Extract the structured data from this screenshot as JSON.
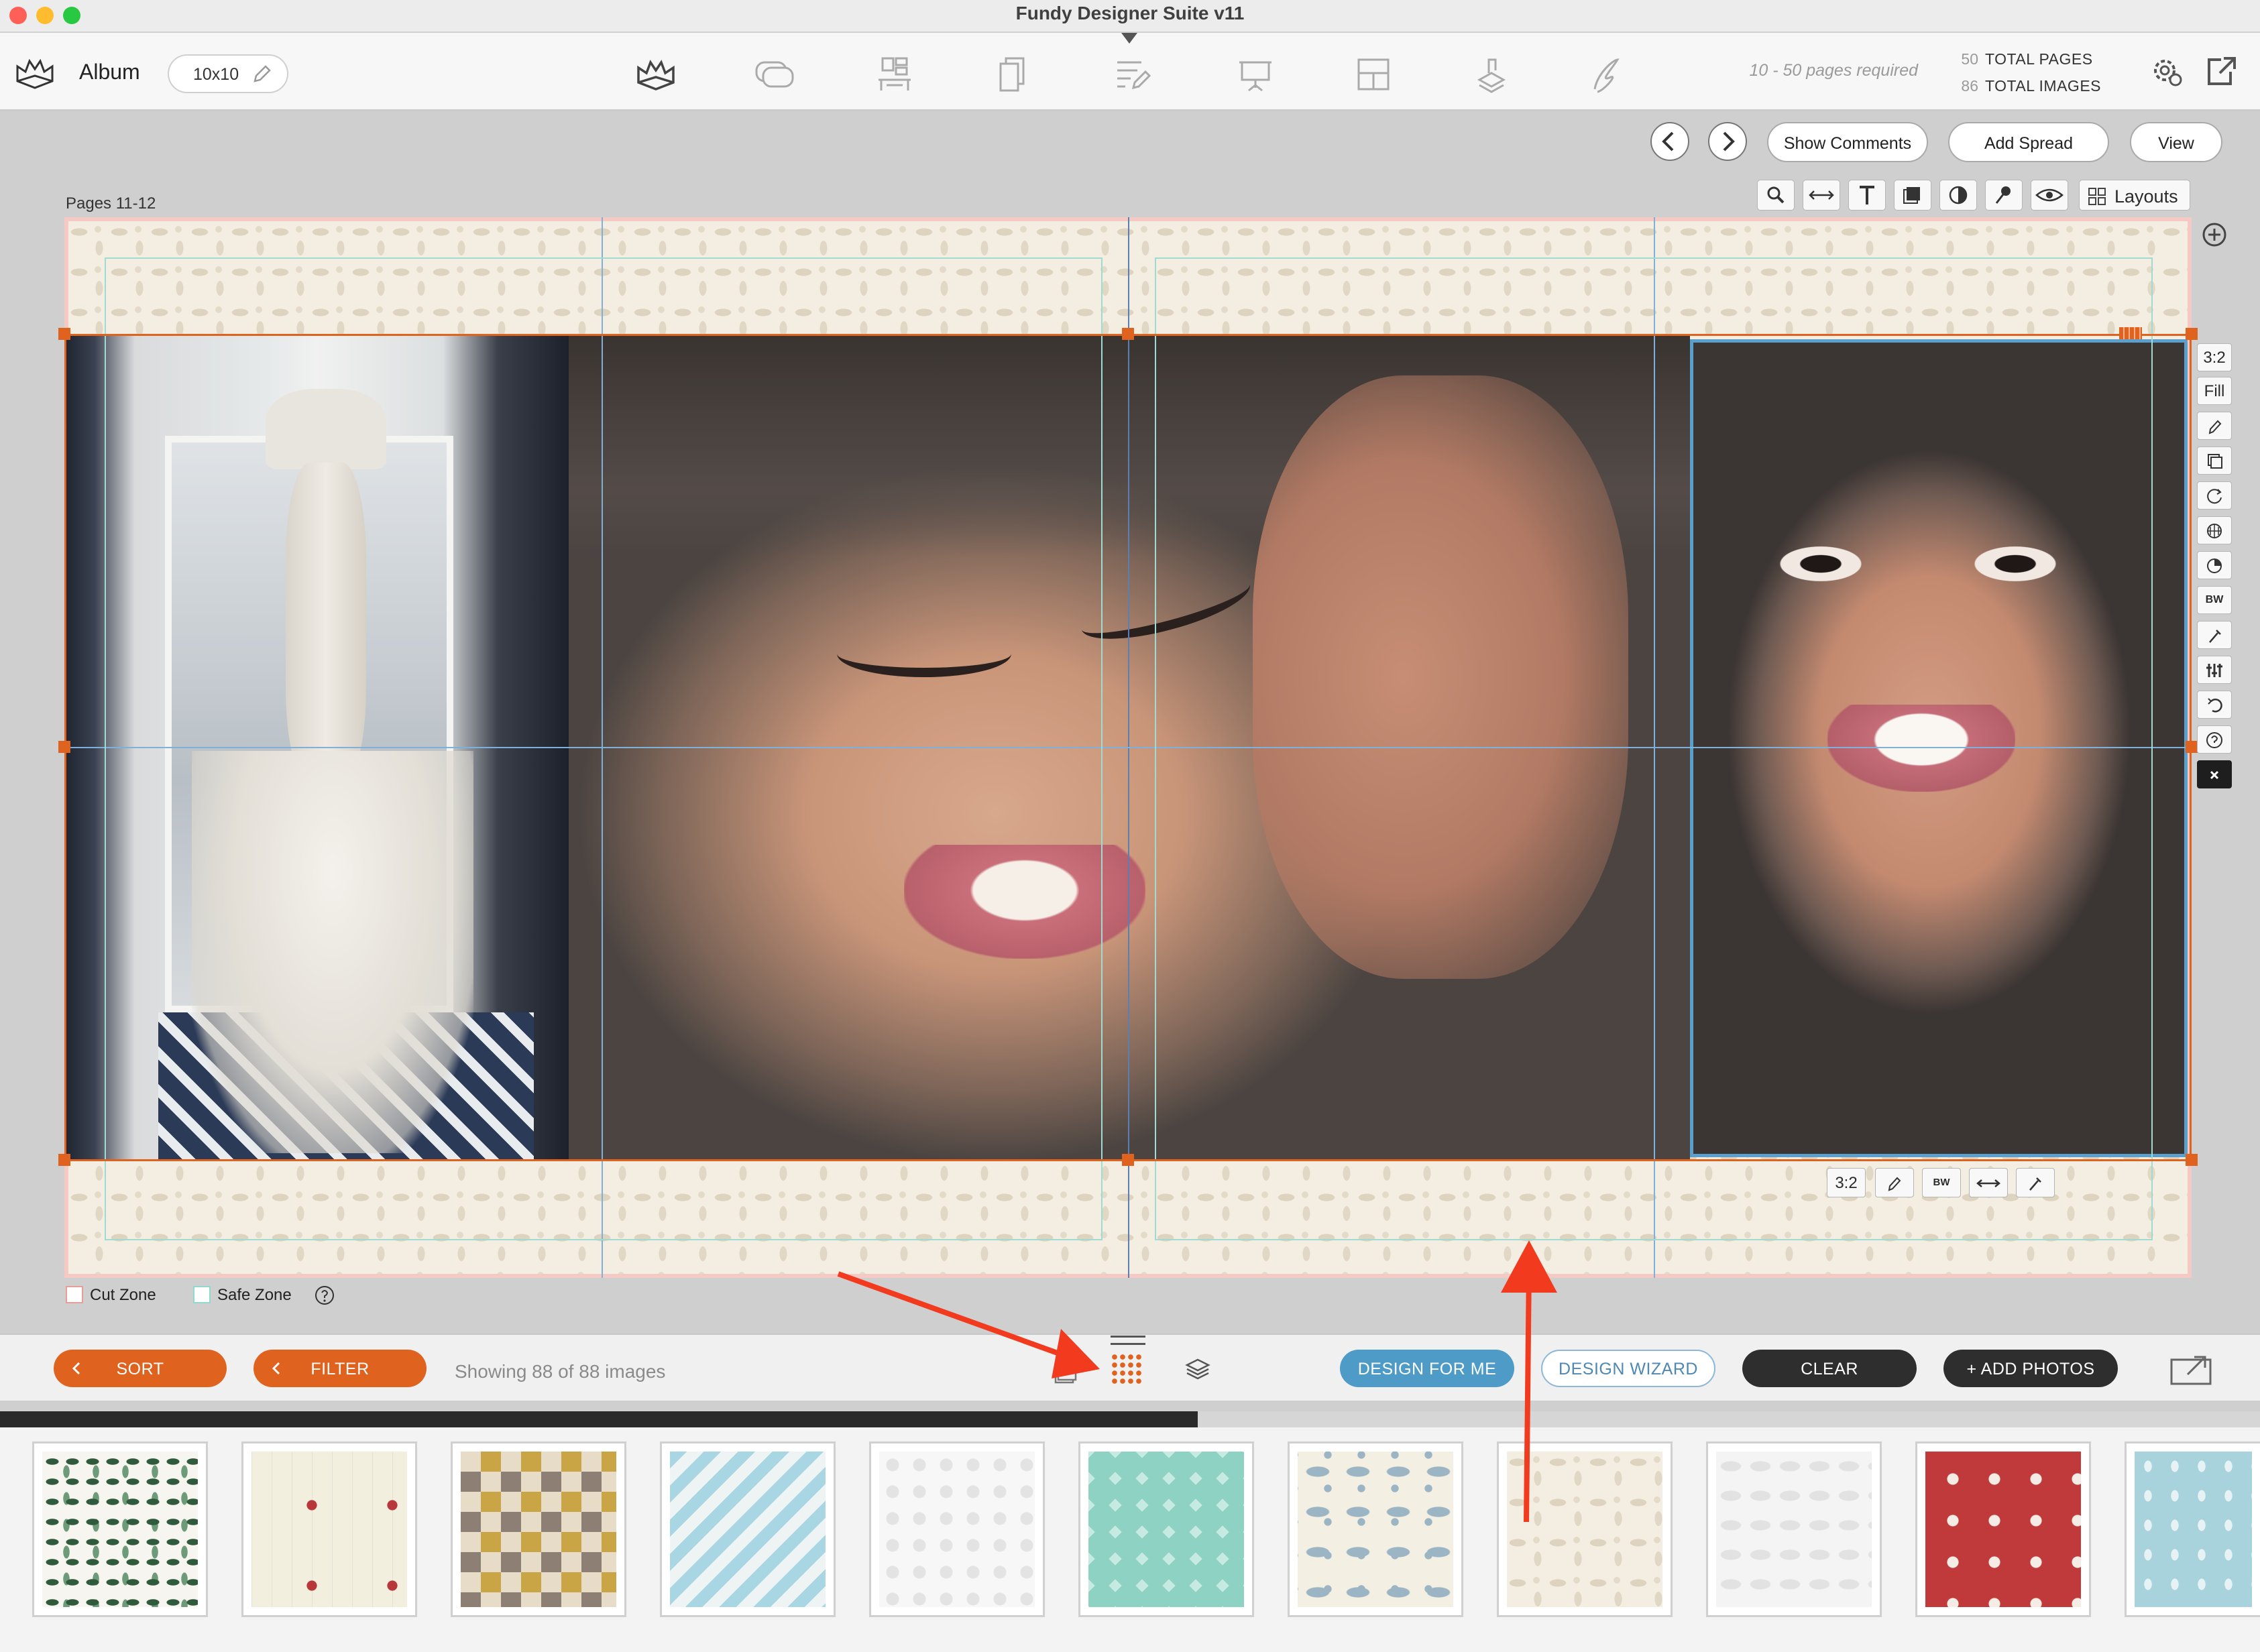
{
  "window": {
    "title": "Fundy Designer Suite v11"
  },
  "toolbar": {
    "product": "Album",
    "size_pill": "10x10",
    "pages_required": "10 - 50 pages required",
    "total_pages_value": "50",
    "total_pages_label": "TOTAL PAGES",
    "total_images_value": "86",
    "total_images_label": "TOTAL IMAGES",
    "tab_icons": [
      "album-icon",
      "comments-icon",
      "wall-art-icon",
      "cards-icon",
      "proofing-icon",
      "slideshow-icon",
      "blog-collage-icon",
      "sales-icon",
      "signature-icon"
    ]
  },
  "workspace": {
    "show_comments": "Show Comments",
    "add_spread": "Add Spread",
    "view": "View",
    "spread_label": "Pages 11-12",
    "layouts": "Layouts",
    "side_tools": [
      "3:2",
      "Fill",
      "BW"
    ],
    "mini_tools": [
      "3:2",
      "BW"
    ],
    "cut_zone": "Cut Zone",
    "safe_zone": "Safe Zone"
  },
  "bottom": {
    "sort": "SORT",
    "filter": "FILTER",
    "showing": "Showing 88 of 88 images",
    "design_for_me": "DESIGN FOR ME",
    "design_wizard": "DESIGN WIZARD",
    "clear": "CLEAR",
    "add_photos": "+ ADD PHOTOS",
    "progress": 0.53
  },
  "colors": {
    "accent_orange": "#e0621f",
    "accent_blue": "#4e9bc7",
    "annotation_red": "#f23a1e"
  }
}
